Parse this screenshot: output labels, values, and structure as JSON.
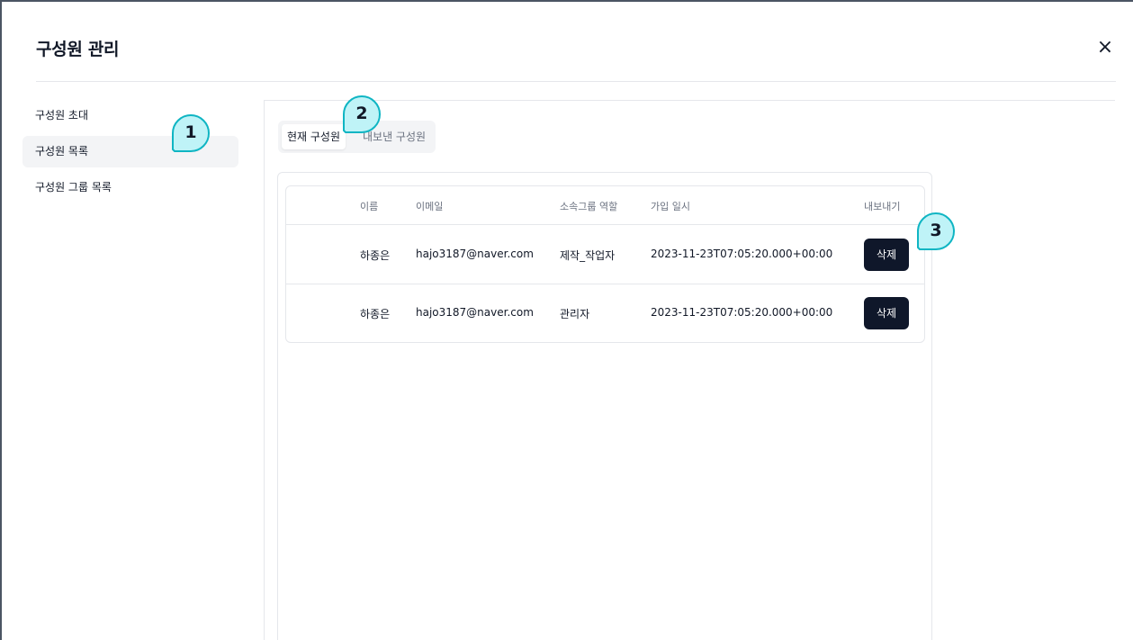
{
  "modal": {
    "title": "구성원 관리",
    "close_icon": "×"
  },
  "sidebar": {
    "items": [
      {
        "label": "구성원 초대",
        "active": false
      },
      {
        "label": "구성원 목록",
        "active": true
      },
      {
        "label": "구성원 그룹 목록",
        "active": false
      }
    ]
  },
  "tabs": [
    {
      "label": "현재 구성원",
      "active": true
    },
    {
      "label": "내보낸 구성원",
      "active": false
    }
  ],
  "table": {
    "headers": [
      "이름",
      "이메일",
      "소속그룹 역할",
      "가입 일시",
      "내보내기"
    ],
    "rows": [
      {
        "name": "하종은",
        "email": "hajo3187@naver.com",
        "role": "제작_작업자",
        "joined": "2023-11-23T07:05:20.000+00:00",
        "action": "삭제"
      },
      {
        "name": "하종은",
        "email": "hajo3187@naver.com",
        "role": "관리자",
        "joined": "2023-11-23T07:05:20.000+00:00",
        "action": "삭제"
      }
    ]
  },
  "callouts": [
    "1",
    "2",
    "3"
  ],
  "colors": {
    "accent_badge_fill": "#bff3f7",
    "accent_badge_stroke": "#0fb5c3",
    "button_bg": "#0f172a"
  }
}
